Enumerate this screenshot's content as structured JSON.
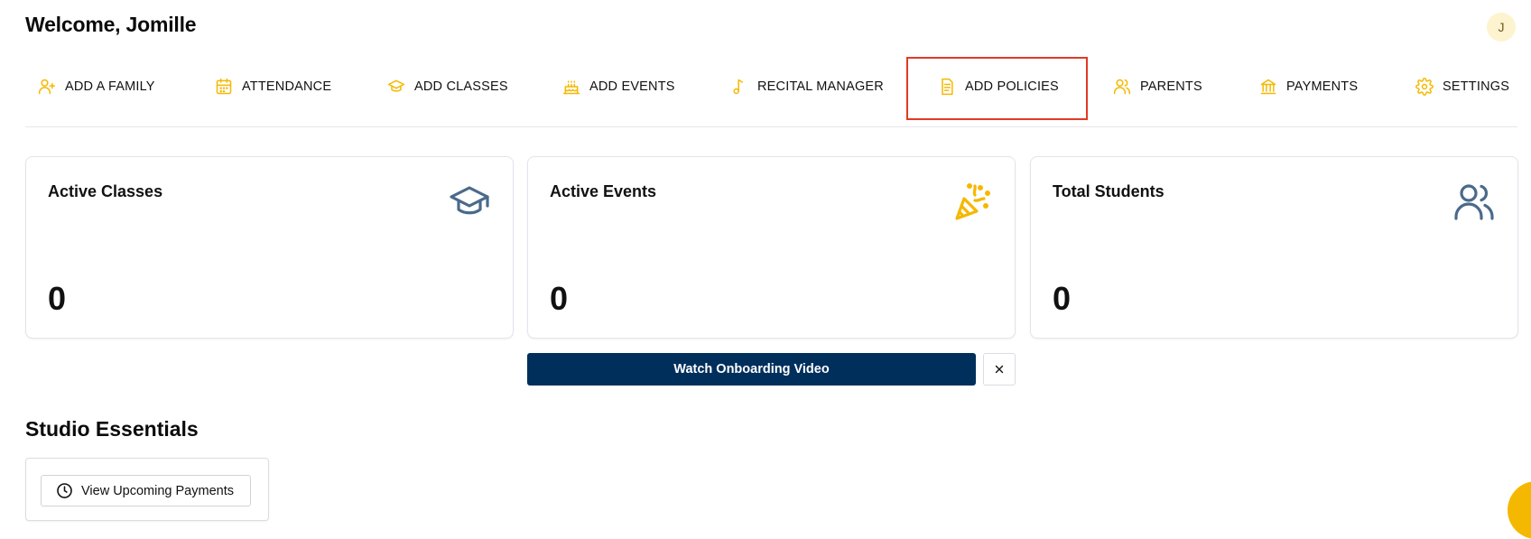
{
  "header": {
    "welcome": "Welcome, Jomille",
    "avatar_initial": "J"
  },
  "nav": {
    "items": [
      {
        "label": "ADD A FAMILY",
        "icon": "user-plus-icon"
      },
      {
        "label": "ATTENDANCE",
        "icon": "calendar-icon"
      },
      {
        "label": "ADD CLASSES",
        "icon": "graduation-cap-icon"
      },
      {
        "label": "ADD EVENTS",
        "icon": "cake-icon"
      },
      {
        "label": "RECITAL MANAGER",
        "icon": "music-note-icon"
      },
      {
        "label": "ADD POLICIES",
        "icon": "document-icon",
        "highlighted": true
      },
      {
        "label": "PARENTS",
        "icon": "users-icon"
      },
      {
        "label": "PAYMENTS",
        "icon": "bank-icon"
      },
      {
        "label": "SETTINGS",
        "icon": "gear-icon"
      }
    ]
  },
  "stats": [
    {
      "title": "Active Classes",
      "value": "0",
      "icon": "graduation-cap-icon"
    },
    {
      "title": "Active Events",
      "value": "0",
      "icon": "party-popper-icon"
    },
    {
      "title": "Total Students",
      "value": "0",
      "icon": "users-icon"
    }
  ],
  "onboarding": {
    "watch_label": "Watch Onboarding Video",
    "close_icon": "close-icon"
  },
  "essentials": {
    "title": "Studio Essentials",
    "upcoming_payments_label": "View Upcoming Payments",
    "upcoming_icon": "clock-icon"
  },
  "colors": {
    "accent": "#f5b800",
    "primary_button": "#002f5c",
    "highlight_border": "#e23a24",
    "icon_slate": "#4a6a8a"
  }
}
